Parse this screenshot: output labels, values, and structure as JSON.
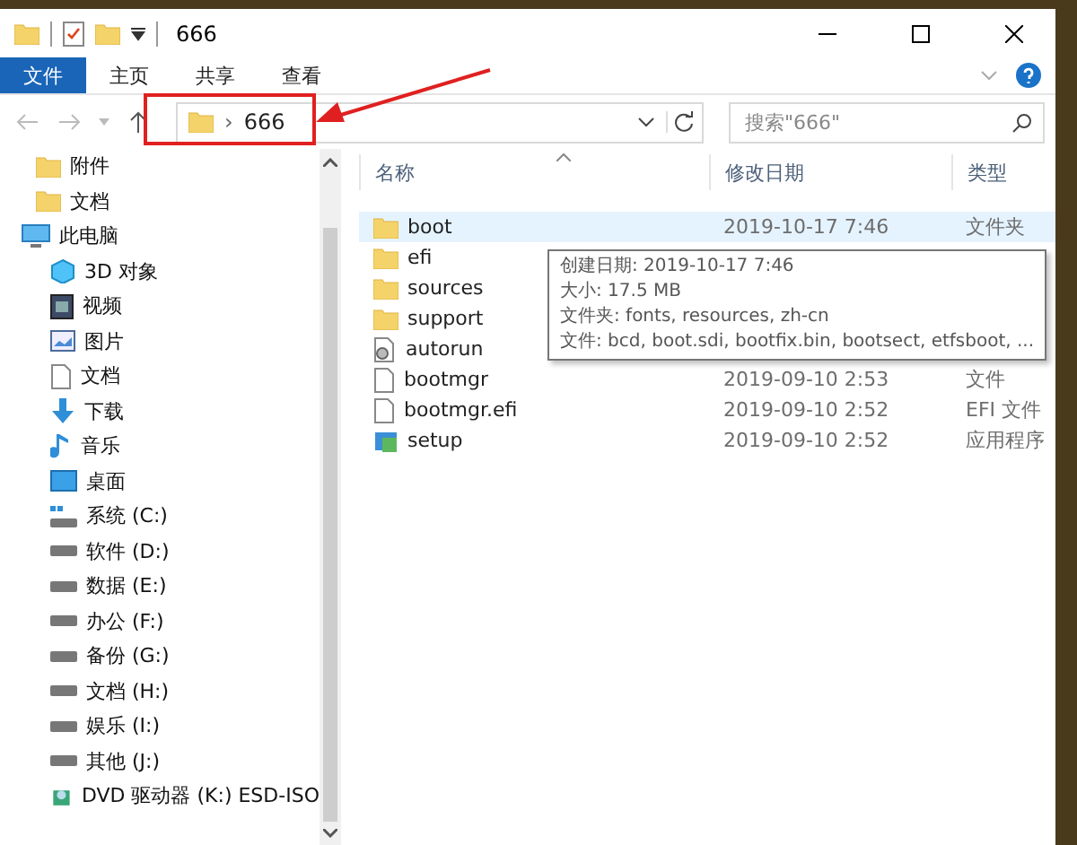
{
  "window": {
    "title": "666"
  },
  "ribbon_tabs": [
    {
      "label": "文件",
      "selected": true
    },
    {
      "label": "主页",
      "selected": false
    },
    {
      "label": "共享",
      "selected": false
    },
    {
      "label": "查看",
      "selected": false
    }
  ],
  "address": {
    "path": "666",
    "separator": "›"
  },
  "search": {
    "placeholder": "搜索\"666\""
  },
  "sidebar": {
    "items": [
      {
        "label": "附件",
        "kind": "folder"
      },
      {
        "label": "文档",
        "kind": "folder"
      },
      {
        "label": "此电脑",
        "kind": "pc",
        "children": [
          {
            "label": "3D 对象",
            "kind": "cube"
          },
          {
            "label": "视频",
            "kind": "video"
          },
          {
            "label": "图片",
            "kind": "picture"
          },
          {
            "label": "文档",
            "kind": "document"
          },
          {
            "label": "下载",
            "kind": "download"
          },
          {
            "label": "音乐",
            "kind": "music"
          },
          {
            "label": "桌面",
            "kind": "desktop"
          },
          {
            "label": "系统 (C:)",
            "kind": "system-drive"
          },
          {
            "label": "软件 (D:)",
            "kind": "drive"
          },
          {
            "label": "数据 (E:)",
            "kind": "drive"
          },
          {
            "label": "办公 (F:)",
            "kind": "drive"
          },
          {
            "label": "备份 (G:)",
            "kind": "drive"
          },
          {
            "label": "文档 (H:)",
            "kind": "drive"
          },
          {
            "label": "娱乐 (I:)",
            "kind": "drive"
          },
          {
            "label": "其他 (J:)",
            "kind": "drive"
          },
          {
            "label": "DVD 驱动器 (K:) ESD-ISO",
            "kind": "dvd"
          }
        ]
      }
    ]
  },
  "table": {
    "columns": [
      "名称",
      "修改日期",
      "类型"
    ],
    "rows": [
      {
        "name": "boot",
        "kind": "folder",
        "date": "2019-10-17 7:46",
        "type": "文件夹",
        "selected": true
      },
      {
        "name": "efi",
        "kind": "folder",
        "selected": false
      },
      {
        "name": "sources",
        "kind": "folder",
        "selected": false
      },
      {
        "name": "support",
        "kind": "folder",
        "selected": false
      },
      {
        "name": "autorun",
        "kind": "settings",
        "selected": false
      },
      {
        "name": "bootmgr",
        "kind": "file",
        "date": "2019-09-10 2:53",
        "type": "文件",
        "selected": false
      },
      {
        "name": "bootmgr.efi",
        "kind": "file",
        "date": "2019-09-10 2:52",
        "type": "EFI 文件",
        "selected": false
      },
      {
        "name": "setup",
        "kind": "app",
        "date": "2019-09-10 2:52",
        "type": "应用程序",
        "selected": false
      }
    ]
  },
  "tooltip": [
    "创建日期: 2019-10-17 7:46",
    "大小: 17.5 MB",
    "文件夹: fonts, resources, zh-cn",
    "文件: bcd, boot.sdi, bootfix.bin, bootsect, etfsboot, ..."
  ]
}
